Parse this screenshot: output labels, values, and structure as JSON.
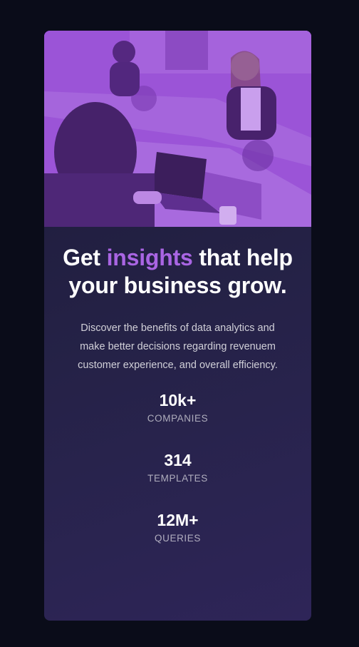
{
  "headline": {
    "before": "Get ",
    "accent": "insights",
    "after": " that help your business grow."
  },
  "description": "Discover the benefits of data analytics and make better decisions regarding revenuem customer experience, and overall efficiency.",
  "stats": [
    {
      "value": "10k+",
      "label": "COMPANIES"
    },
    {
      "value": "314",
      "label": "TEMPLATES"
    },
    {
      "value": "12M+",
      "label": "QUERIES"
    }
  ],
  "colors": {
    "page_background": "#0a0c19",
    "card_background": "#1c1a38",
    "accent": "#a965e3",
    "image_overlay": "#9a54d6"
  }
}
